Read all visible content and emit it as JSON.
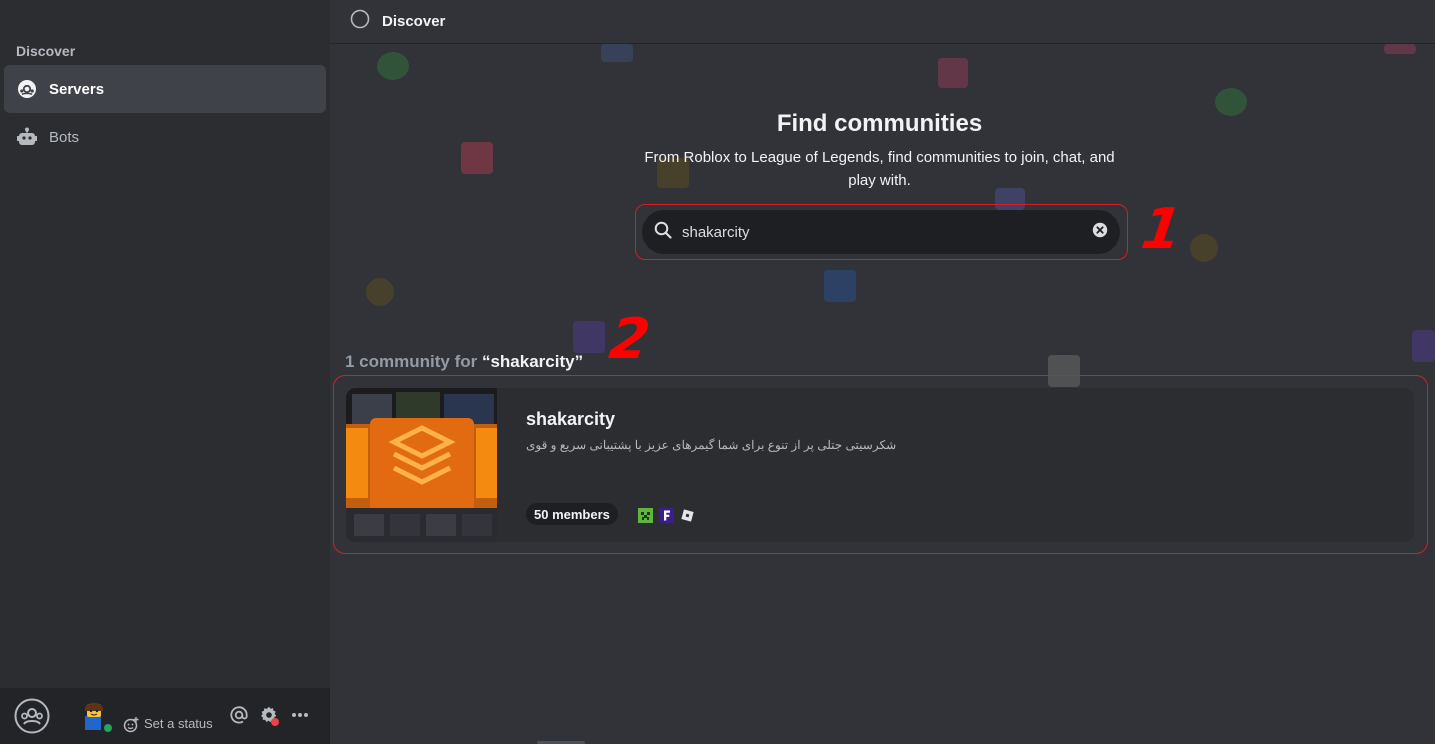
{
  "sidebar": {
    "heading": "Discover",
    "items": [
      {
        "label": "Servers",
        "icon": "compass-icon",
        "active": true
      },
      {
        "label": "Bots",
        "icon": "robot-icon",
        "active": false
      }
    ]
  },
  "userbar": {
    "status_label": "Set a status",
    "avatar_status": "online",
    "colors": {
      "online": "#23a55a",
      "notify": "#f23f43"
    }
  },
  "topbar": {
    "title": "Discover"
  },
  "hero": {
    "title": "Find communities",
    "subtitle": "From Roblox to League of Legends, find communities to join, chat, and play with."
  },
  "search": {
    "value": "shakarcity"
  },
  "annotations": {
    "one": "1",
    "two": "2"
  },
  "results": {
    "count_text": "1 community for ",
    "query_text": "“shakarcity”",
    "cards": [
      {
        "name": "shakarcity",
        "description": "شکرسیتی جتلی پر از تنوع برای شما گیمرهای عزیز با پشتیبانی سریع و قوی",
        "members": "50 members",
        "games": [
          "minecraft-icon",
          "fortnite-icon",
          "roblox-icon"
        ]
      }
    ]
  },
  "colors": {
    "accent_red": "#d41f2a",
    "background": "#313338",
    "sidebar": "#2b2d31"
  }
}
